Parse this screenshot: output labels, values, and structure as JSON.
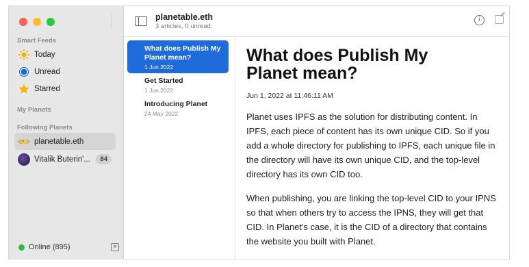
{
  "sidebar": {
    "smart_feeds_label": "Smart Feeds",
    "smart_feeds": [
      {
        "label": "Today",
        "icon": "sun-icon"
      },
      {
        "label": "Unread",
        "icon": "circle-icon"
      },
      {
        "label": "Starred",
        "icon": "star-icon"
      }
    ],
    "my_planets_label": "My Planets",
    "following_label": "Following Planets",
    "following": [
      {
        "label": "planetable.eth",
        "icon": "planet-avatar"
      },
      {
        "label": "Vitalik Buterin'...",
        "icon": "vitalik-avatar",
        "badge": "84"
      }
    ],
    "status": "Online (895)"
  },
  "toolbar": {
    "title": "planetable.eth",
    "subtitle": "3 articles, 0 unread."
  },
  "articles": [
    {
      "title": "What does Publish My Planet mean?",
      "date": "1 Jun 2022",
      "selected": true
    },
    {
      "title": "Get Started",
      "date": "1 Jun 2022"
    },
    {
      "title": "Introducing Planet",
      "date": "24 May 2022"
    }
  ],
  "content": {
    "title": "What does Publish My Planet mean?",
    "date": "Jun 1, 2022 at 11:46:11 AM",
    "paragraphs": [
      "Planet uses IPFS as the solution for distributing content. In IPFS, each piece of content has its own unique CID. So if you add a whole directory for publishing to IPFS, each unique file in the directory will have its own unique CID, and the top-level directory has its own CID too.",
      "When publishing, you are linking the top-level CID to your IPNS so that when others try to access the IPNS, they will get that CID. In Planet's case, it is the CID of a directory that contains the website you built with Planet."
    ]
  },
  "colors": {
    "accent": "#1f6bdb",
    "online": "#2fb83f"
  }
}
